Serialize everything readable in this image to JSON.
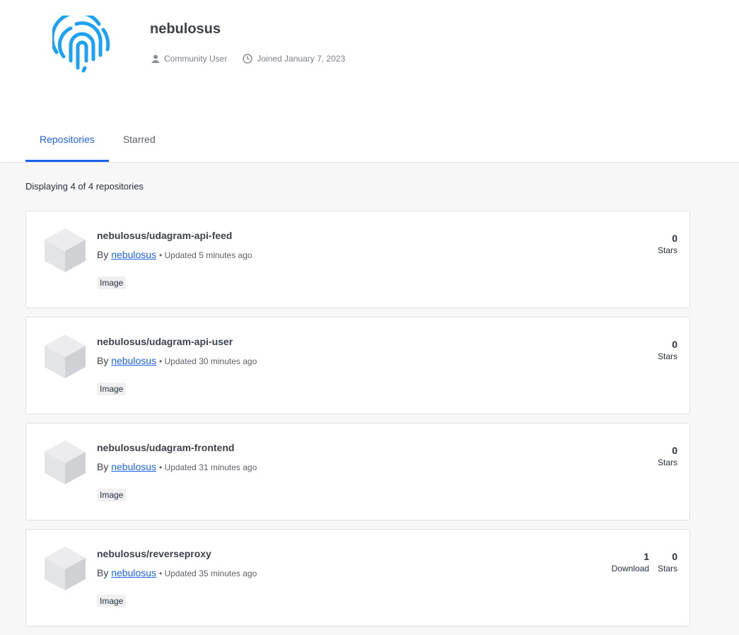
{
  "profile": {
    "username": "nebulosus",
    "role": "Community User",
    "joined": "Joined January 7, 2023"
  },
  "tabs": [
    {
      "label": "Repositories"
    },
    {
      "label": "Starred"
    }
  ],
  "count_text": "Displaying 4 of 4 repositories",
  "repos": [
    {
      "name": "nebulosus/udagram-api-feed",
      "by": "By",
      "owner": "nebulosus",
      "updated": "• Updated 5 minutes ago",
      "badge": "Image",
      "stars": "0",
      "stars_label": "Stars"
    },
    {
      "name": "nebulosus/udagram-api-user",
      "by": "By",
      "owner": "nebulosus",
      "updated": "• Updated 30 minutes ago",
      "badge": "Image",
      "stars": "0",
      "stars_label": "Stars"
    },
    {
      "name": "nebulosus/udagram-frontend",
      "by": "By",
      "owner": "nebulosus",
      "updated": "• Updated 31 minutes ago",
      "badge": "Image",
      "stars": "0",
      "stars_label": "Stars"
    },
    {
      "name": "nebulosus/reverseproxy",
      "by": "By",
      "owner": "nebulosus",
      "updated": "• Updated 35 minutes ago",
      "badge": "Image",
      "downloads": "1",
      "downloads_label": "Download",
      "stars": "0",
      "stars_label": "Stars"
    }
  ]
}
